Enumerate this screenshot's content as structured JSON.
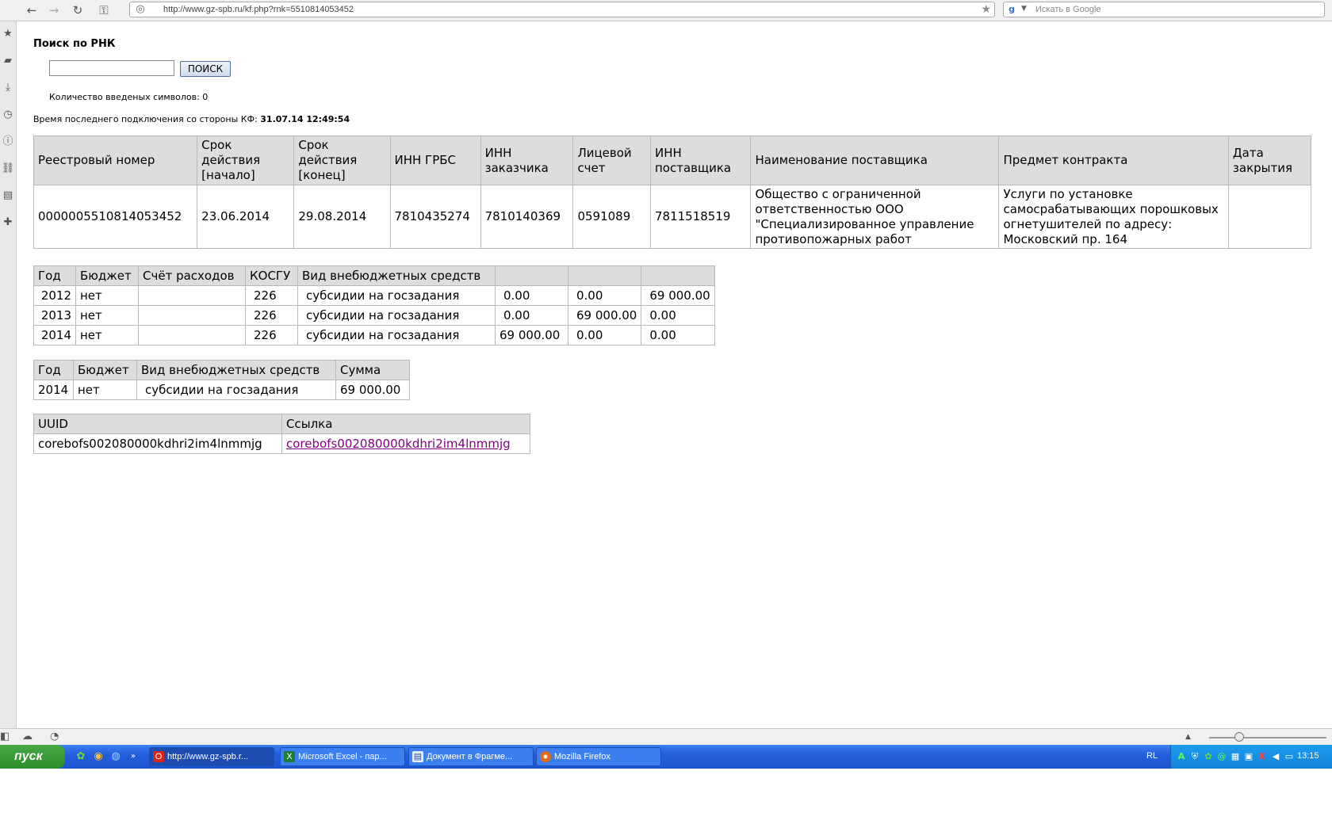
{
  "browser": {
    "url": "http://www.gz-spb.ru/kf.php?rnk=5510814053452",
    "search_placeholder": "Искать в Google",
    "search_engine_letter": "g"
  },
  "page": {
    "title": "Поиск по РНК",
    "search_button": "ПОИСК",
    "char_count_label": "Количество введеных символов: 0",
    "last_conn_label": "Время последнего подключения со стороны КФ:",
    "last_conn_value": "31.07.14 12:49:54"
  },
  "main_table": {
    "headers": [
      "Реестровый номер",
      "Срок действия [начало]",
      "Срок действия [конец]",
      "ИНН ГРБС",
      "ИНН заказчика",
      "Лицевой счет",
      "ИНН поставщика",
      "Наименование поставщика",
      "Предмет контракта",
      "Дата закрытия"
    ],
    "row": [
      "0000005510814053452",
      "23.06.2014",
      "29.08.2014",
      "7810435274",
      "7810140369",
      "0591089",
      "7811518519",
      "Общество с ограниченной ответственностью ООО \"Специализированное управление противопожарных работ",
      "Услуги по установке самосрабатывающих порошковых огнетушителей по адресу: Московский пр. 164",
      ""
    ]
  },
  "budget_table": {
    "headers": [
      "Год",
      "Бюджет",
      "Счёт расходов",
      "КОСГУ",
      "Вид внебюджетных средств",
      "",
      "",
      ""
    ],
    "rows": [
      [
        "2012",
        "нет",
        "",
        "226",
        "субсидии на госзадания",
        "0.00",
        "0.00",
        "69 000.00"
      ],
      [
        "2013",
        "нет",
        "",
        "226",
        "субсидии на госзадания",
        "0.00",
        "69 000.00",
        "0.00"
      ],
      [
        "2014",
        "нет",
        "",
        "226",
        "субсидии на госзадания",
        "69 000.00",
        "0.00",
        "0.00"
      ]
    ]
  },
  "sum_table": {
    "headers": [
      "Год",
      "Бюджет",
      "Вид внебюджетных средств",
      "Сумма"
    ],
    "rows": [
      [
        "2014",
        "нет",
        "субсидии на госзадания",
        "69 000.00"
      ]
    ]
  },
  "uuid_table": {
    "headers": [
      "UUID",
      "Ссылка"
    ],
    "rows": [
      [
        "corebofs002080000kdhri2im4lnmmjg",
        "corebofs002080000kdhri2im4lnmmjg"
      ]
    ]
  },
  "taskbar": {
    "start_label": "пуск",
    "tasks": [
      "http://www.gz-spb.r...",
      "Microsoft Excel - пар...",
      "Документ в Фрагме...",
      "Mozilla Firefox"
    ],
    "language": "RL",
    "clock": "13:15"
  }
}
